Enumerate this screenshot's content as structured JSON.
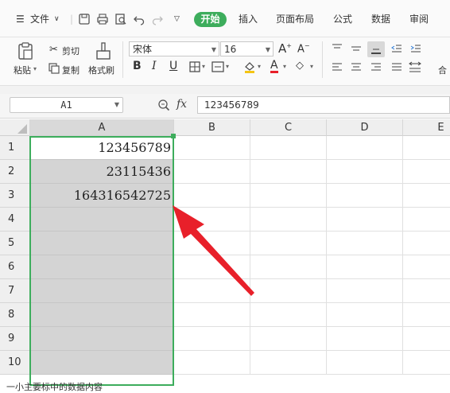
{
  "menubar": {
    "file_label": "文件",
    "tabs": [
      "开始",
      "插入",
      "页面布局",
      "公式",
      "数据",
      "审阅"
    ]
  },
  "ribbon": {
    "paste_label": "粘贴",
    "cut_label": "剪切",
    "copy_label": "复制",
    "format_painter_label": "格式刷",
    "font_name": "宋体",
    "font_size": "16",
    "more_label": "合"
  },
  "formula_bar": {
    "cell_ref": "A1",
    "fx_label": "fx",
    "content": "123456789"
  },
  "sheet": {
    "columns": [
      "A",
      "B",
      "C",
      "D",
      "E"
    ],
    "rows": [
      "1",
      "2",
      "3",
      "4",
      "5",
      "6",
      "7",
      "8",
      "9",
      "10"
    ],
    "cells_A": [
      "123456789",
      "23115436",
      "164316542725",
      "",
      "",
      "",
      "",
      "",
      "",
      ""
    ]
  },
  "caption": "一小主要标中的数据内容",
  "colors": {
    "accent": "#3dad5c",
    "arrow": "#e8202a"
  }
}
